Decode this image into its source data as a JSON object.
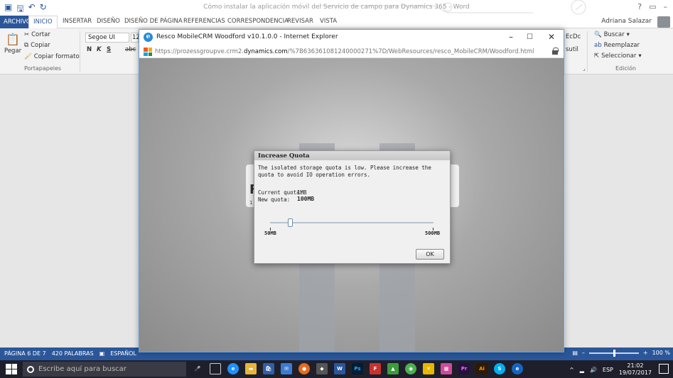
{
  "word": {
    "doc_title": "Cómo instalar la aplicación móvil del Servicio de campo para Dynamics 365 - Word",
    "tabs": [
      "ARCHIVO",
      "INICIO",
      "INSERTAR",
      "DISEÑO",
      "DISEÑO DE PÁGINA",
      "REFERENCIAS",
      "CORRESPONDENCIA",
      "REVISAR",
      "VISTA"
    ],
    "user": "Adriana Salazar",
    "clipboard": {
      "cut": "Cortar",
      "copy": "Copiar",
      "paste": "Pegar",
      "format_painter": "Copiar formato",
      "group": "Portapapeles"
    },
    "font": {
      "name": "Segoe UI",
      "size": "12",
      "bold": "N",
      "italic": "K",
      "underline": "S",
      "abc": "abc"
    },
    "styles": {
      "partial1": "EcDc",
      "partial2": "sutil"
    },
    "editing": {
      "find": "Buscar",
      "replace": "Reemplazar",
      "select": "Seleccionar",
      "group": "Edición"
    },
    "status": {
      "page": "PÁGINA 6 DE 7",
      "words": "420 PALABRAS",
      "lang": "ESPAÑOL",
      "zoom": "100 %"
    }
  },
  "ie": {
    "title": "Resco MobileCRM Woodford v10.1.0.0 - Internet Explorer",
    "url_pre": "https://prozessgroupve.crm2.",
    "url_domain": "dynamics.com",
    "url_post": "/%7B636361081240000271%7D/WebResources/resco_MobileCRM/Woodford.html",
    "ghost_letter": "F",
    "ghost_line": "1"
  },
  "dialog": {
    "title": "Increase Quota",
    "message": "The isolated storage quota is low. Please increase the quota to avoid IO operation errors.",
    "current_label": "Current quota:",
    "current_value": "1MB",
    "new_label": "New quota:",
    "new_value": "100MB",
    "slider_min": "50MB",
    "slider_max": "500MB",
    "slider_fraction": 0.11,
    "ok": "OK"
  },
  "taskbar": {
    "search_placeholder": "Escribe aquí para buscar",
    "lang": "ESP",
    "time": "21:02",
    "date": "19/07/2017"
  }
}
